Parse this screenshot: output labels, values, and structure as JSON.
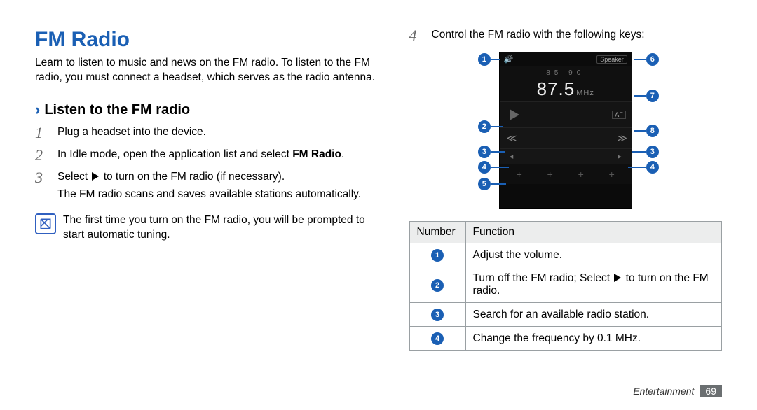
{
  "title": "FM Radio",
  "intro": "Learn to listen to music and news on the FM radio. To listen to the FM radio, you must connect a headset, which serves as the radio antenna.",
  "subheading": "Listen to the FM radio",
  "steps": {
    "s1": {
      "num": "1",
      "text": "Plug a headset into the device."
    },
    "s2": {
      "num": "2",
      "text_a": "In Idle mode, open the application list and select ",
      "bold": "FM Radio",
      "text_b": "."
    },
    "s3": {
      "num": "3",
      "text_a": "Select ",
      "text_b": " to turn on the FM radio (if necessary).",
      "text_c": "The FM radio scans and saves available stations automatically."
    },
    "note": "The first time you turn on the FM radio, you will be prompted to start automatic tuning.",
    "s4": {
      "num": "4",
      "text": "Control the FM radio with the following keys:"
    }
  },
  "radio_ui": {
    "speaker_label": "Speaker",
    "presets": "85    90",
    "frequency": "87.5",
    "unit": "MHz",
    "af_label": "AF"
  },
  "callout_labels": {
    "n1": "1",
    "n2": "2",
    "n3": "3",
    "n4": "4",
    "n5": "5",
    "n6": "6",
    "n7": "7",
    "n8": "8"
  },
  "table": {
    "head_number": "Number",
    "head_function": "Function",
    "rows": [
      {
        "n": "1",
        "func": "Adjust the volume."
      },
      {
        "n": "2",
        "func_a": "Turn off the FM radio; Select ",
        "func_b": " to turn on the FM radio."
      },
      {
        "n": "3",
        "func": "Search for an available radio station."
      },
      {
        "n": "4",
        "func": "Change the frequency by 0.1 MHz."
      }
    ]
  },
  "footer": {
    "section": "Entertainment",
    "page": "69"
  }
}
